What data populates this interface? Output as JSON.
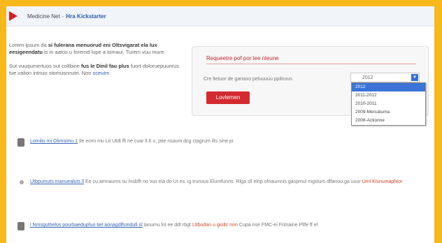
{
  "header": {
    "section": "Medicine Net",
    "separator": "-",
    "current": "Hra Kickstarter"
  },
  "intro": {
    "p1_start": "Lorem ipsum da",
    "p1_bold": "si fulerana menuorud eni Oltsvigarat ela lux eesigeendatu",
    "p1_rest": "is in aatos u foremd lupe a tomaui. Turem vuu mure.",
    "p2_start": "Sut vuuqumertuos sut coltbine",
    "p2_bold": "fus le Dinil fau plus",
    "p2_rest": "fuort doloruepuunrus tue valion intnuo stomusnnutri. Non",
    "p2_link": "sceuim"
  },
  "widget": {
    "title": "Requeetre pof por lee nleune",
    "label": "Cre ltetuor de garraxo peluuuuu ppilnous",
    "select_value": "2012",
    "options": [
      "2012",
      "2011-2012",
      "2010-2011",
      "2009-Mercatuma",
      "2008-Actionne"
    ],
    "selected_index": 0,
    "button": "Lovlemen"
  },
  "news": [
    {
      "link": "Lomilis mi Olimsimu 1",
      "text": "Ile ecmi mu Lit Utdt ffi ne cuar ll.6 u. ptie nsaum dcg ctagrum ilts sine",
      "tail": "pi",
      "highlight": ""
    },
    {
      "link": "Utbpumuts manuealuts ll",
      "text": "Ee cu amnaums su lnsbflt no vus ela do Ur.es. ig trunsus Elumfunrts. Rlga sll elnp ofnaumnis gaspmul mgsturs dlfanou ga uuur",
      "tail": "",
      "highlight": "Uml Klsnumaphtor"
    },
    {
      "link": "l Nmsguthelos pourbaedupfuo tiel aonagdlfsmdufi sl",
      "text": "lanumu lnl ee ddt rbgt",
      "tail": "Cupa nse FMC-ei Fnlnaine Pllfe ff el",
      "highlight": "Lttbudan u gioltc nnn"
    }
  ]
}
